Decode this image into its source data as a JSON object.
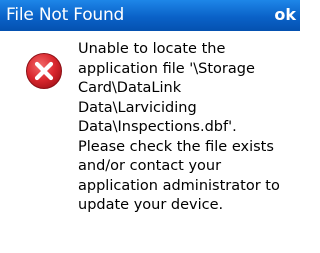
{
  "titlebar": {
    "title": "File Not Found",
    "ok_label": "ok"
  },
  "dialog": {
    "icon": "error-x-icon",
    "message": "Unable to locate the\napplication file '\\Storage\nCard\\DataLink\nData\\Larviciding\nData\\Inspections.dbf'.\nPlease check the file exists\nand/or contact your\napplication administrator to\nupdate your device."
  },
  "colors": {
    "titlebar": "#0a62c8",
    "title_text": "#ffffff",
    "icon_red": "#d9262d"
  }
}
